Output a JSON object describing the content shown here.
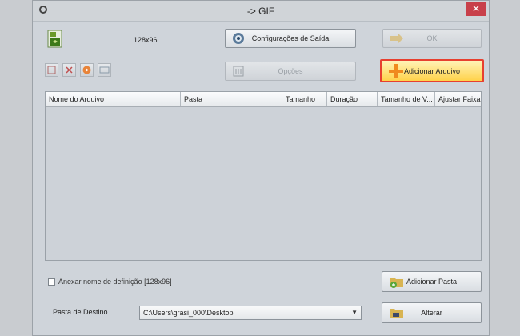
{
  "window": {
    "title": "-> GIF",
    "close_glyph": "✕"
  },
  "format": {
    "resolution": "128x96",
    "icon": "gif-file-icon"
  },
  "buttons": {
    "output_settings": "Configurações de Saída",
    "ok": "OK",
    "options": "Opções",
    "add_file": "Adicionar Arquivo",
    "add_folder": "Adicionar Pasta",
    "change": "Alterar"
  },
  "list": {
    "columns": [
      "Nome do Arquivo",
      "Pasta",
      "Tamanho",
      "Duração",
      "Tamanho de V...",
      "Ajustar Faixa"
    ]
  },
  "options": {
    "append_name_label": "Anexar nome de definição [128x96]"
  },
  "destination": {
    "label": "Pasta de Destino",
    "value": "C:\\Users\\grasi_000\\Desktop"
  },
  "colors": {
    "accent_border": "#e7402f",
    "accent_fill": "#ffd24a"
  }
}
